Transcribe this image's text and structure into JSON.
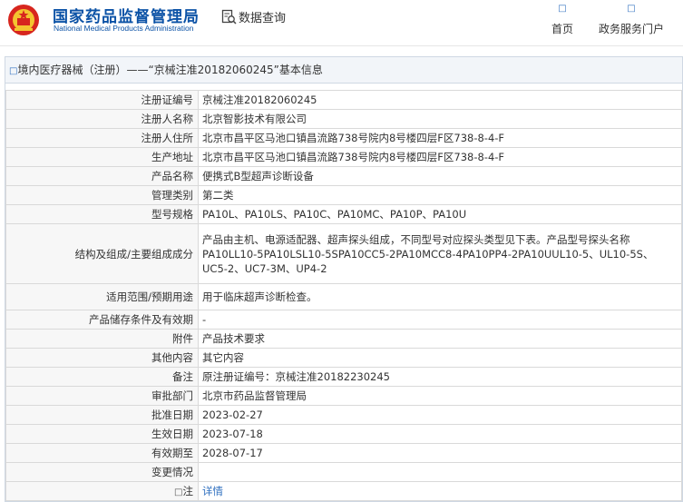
{
  "site": {
    "title_cn": "国家药品监督管理局",
    "title_en": "National Medical Products Administration"
  },
  "search": {
    "label": "数据查询"
  },
  "nav": {
    "home": "首页",
    "gov": "政务服务门户"
  },
  "panel": {
    "heading": "境内医疗器械（注册）——“京械注准20182060245”基本信息"
  },
  "rows": [
    {
      "key": "注册证编号",
      "value": "京械注准20182060245"
    },
    {
      "key": "注册人名称",
      "value": "北京智影技术有限公司"
    },
    {
      "key": "注册人住所",
      "value": "北京市昌平区马池口镇昌流路738号院内8号楼四层F区738-8-4-F"
    },
    {
      "key": "生产地址",
      "value": "北京市昌平区马池口镇昌流路738号院内8号楼四层F区738-8-4-F"
    },
    {
      "key": "产品名称",
      "value": "便携式B型超声诊断设备"
    },
    {
      "key": "管理类别",
      "value": "第二类"
    },
    {
      "key": "型号规格",
      "value": "PA10L、PA10LS、PA10C、PA10MC、PA10P、PA10U"
    },
    {
      "key": "结构及组成/主要组成成分",
      "value": "产品由主机、电源适配器、超声探头组成，不同型号对应探头类型见下表。产品型号探头名称PA10LL10-5PA10LSL10-5SPA10CC5-2PA10MCC8-4PA10PP4-2PA10UUL10-5、UL10-5S、UC5-2、UC7-3M、UP4-2"
    },
    {
      "key": "适用范围/预期用途",
      "value": "用于临床超声诊断检查。"
    },
    {
      "key": "产品储存条件及有效期",
      "value": "-"
    },
    {
      "key": "附件",
      "value": "产品技术要求"
    },
    {
      "key": "其他内容",
      "value": "其它内容"
    },
    {
      "key": "备注",
      "value": "原注册证编号：京械注准20182230245"
    },
    {
      "key": "审批部门",
      "value": "北京市药品监督管理局"
    },
    {
      "key": "批准日期",
      "value": "2023-02-27"
    },
    {
      "key": "生效日期",
      "value": "2023-07-18"
    },
    {
      "key": "有效期至",
      "value": "2028-07-17"
    },
    {
      "key": "变更情况",
      "value": ""
    },
    {
      "key": "注",
      "value": "详情"
    }
  ],
  "colors": {
    "brand": "#0b52a6",
    "link": "#2f6fbf"
  }
}
